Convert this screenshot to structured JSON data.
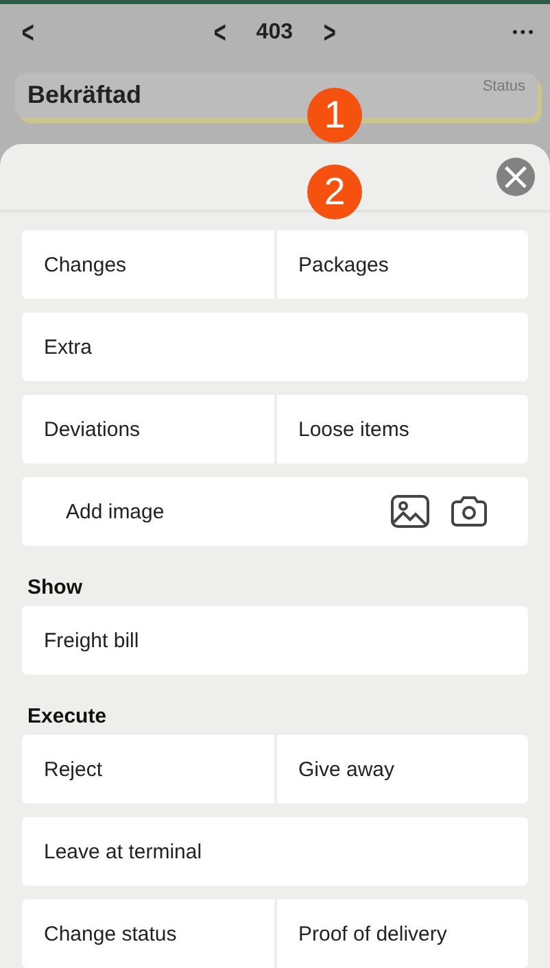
{
  "header": {
    "back": "<",
    "prev": "<",
    "number": "403",
    "next": ">",
    "more": "•••"
  },
  "status_card": {
    "value": "Bekräftad",
    "label": "Status"
  },
  "markers": [
    {
      "text": "1"
    },
    {
      "text": "2"
    }
  ],
  "sheet": {
    "close": "×",
    "sections": [
      {
        "rows": [
          {
            "kind": "pair",
            "items": [
              "Changes",
              "Packages"
            ]
          },
          {
            "kind": "single",
            "items": [
              "Extra"
            ]
          },
          {
            "kind": "pair",
            "items": [
              "Deviations",
              "Loose items"
            ]
          },
          {
            "kind": "image",
            "items": [
              "Add image"
            ]
          }
        ]
      },
      {
        "title": "Show",
        "rows": [
          {
            "kind": "single",
            "items": [
              "Freight bill"
            ]
          }
        ]
      },
      {
        "title": "Execute",
        "rows": [
          {
            "kind": "pair",
            "items": [
              "Reject",
              "Give away"
            ]
          },
          {
            "kind": "single",
            "items": [
              "Leave at terminal"
            ]
          },
          {
            "kind": "pair",
            "items": [
              "Change status",
              "Proof of delivery"
            ]
          }
        ]
      }
    ]
  }
}
